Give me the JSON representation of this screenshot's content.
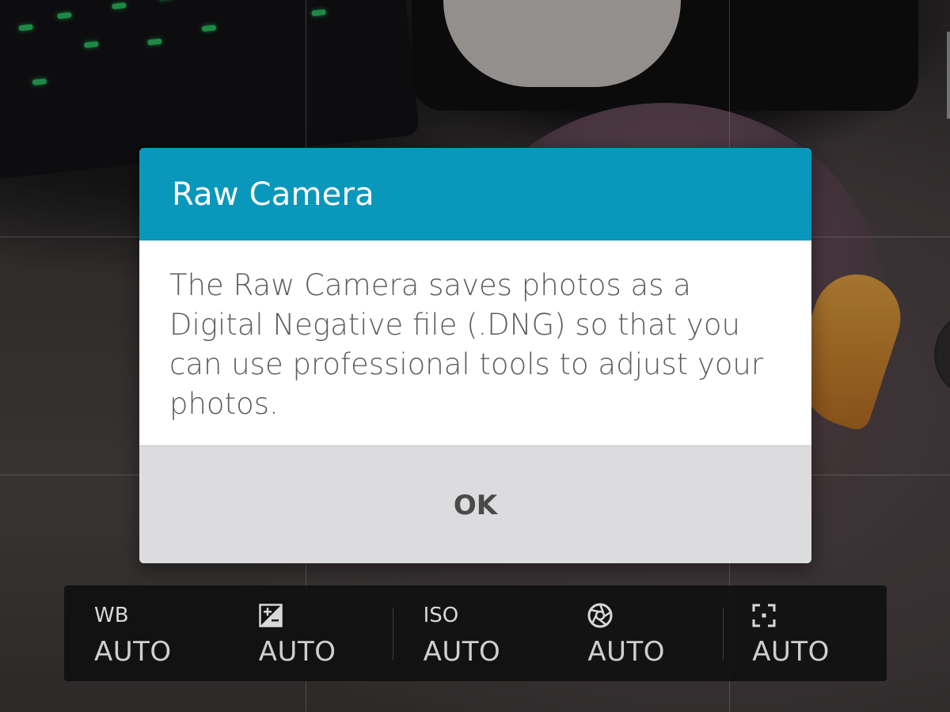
{
  "dialog": {
    "title": "Raw Camera",
    "message": "The Raw Camera saves photos as a Digital Negative file (.DNG) so that you can use professional tools to adjust your photos.",
    "ok_label": "OK",
    "header_color": "#0997bb"
  },
  "settings_bar": {
    "items": [
      {
        "icon": "white-balance-label",
        "icon_text": "WB",
        "value": "AUTO"
      },
      {
        "icon": "exposure-compensation-icon",
        "icon_text": "",
        "value": "AUTO"
      },
      {
        "icon": "iso-label",
        "icon_text": "ISO",
        "value": "AUTO"
      },
      {
        "icon": "shutter-aperture-icon",
        "icon_text": "",
        "value": "AUTO"
      },
      {
        "icon": "focus-icon",
        "icon_text": "",
        "value": "AUTO"
      }
    ]
  }
}
